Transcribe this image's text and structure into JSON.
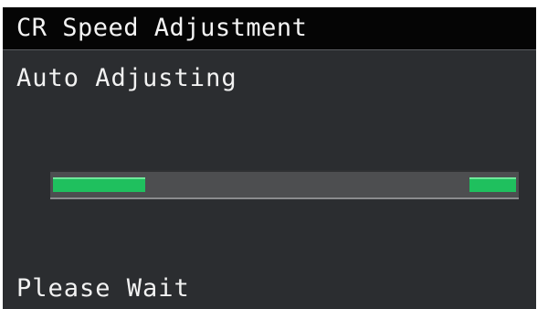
{
  "header": {
    "title": "CR Speed Adjustment"
  },
  "status": {
    "message": "Auto Adjusting",
    "progress": {
      "style": "indeterminate",
      "color": "#1fc05e"
    }
  },
  "footer": {
    "message": "Please Wait"
  },
  "colors": {
    "title_bar_bg": "#050505",
    "screen_bg": "#2b2d30",
    "text": "#f2f2f2",
    "progress_accent": "#1fc05e"
  }
}
